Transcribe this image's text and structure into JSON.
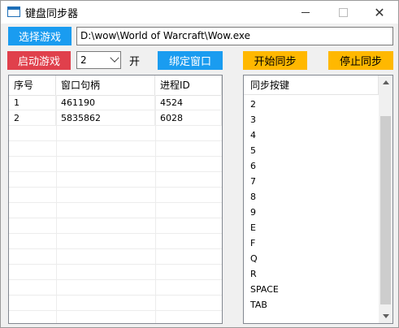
{
  "window": {
    "title": "键盘同步器",
    "close_glyph": "✕"
  },
  "toolbar": {
    "select_game_label": "选择游戏",
    "game_path": "D:\\wow\\World of Warcraft\\Wow.exe",
    "launch_game_label": "启动游戏",
    "count_value": "2",
    "open_label": "开",
    "bind_window_label": "绑定窗口",
    "start_sync_label": "开始同步",
    "stop_sync_label": "停止同步"
  },
  "colors": {
    "blue": "#1a9cf0",
    "red": "#e0404c",
    "yellow": "#ffb800"
  },
  "window_table": {
    "headers": [
      "序号",
      "窗口句柄",
      "进程ID"
    ],
    "rows": [
      [
        "1",
        "461190",
        "4524"
      ],
      [
        "2",
        "5835862",
        "6028"
      ]
    ]
  },
  "sync_keys": {
    "header": "同步按键",
    "items": [
      "2",
      "3",
      "4",
      "5",
      "6",
      "7",
      "8",
      "9",
      "E",
      "F",
      "Q",
      "R",
      "SPACE",
      "TAB"
    ]
  }
}
